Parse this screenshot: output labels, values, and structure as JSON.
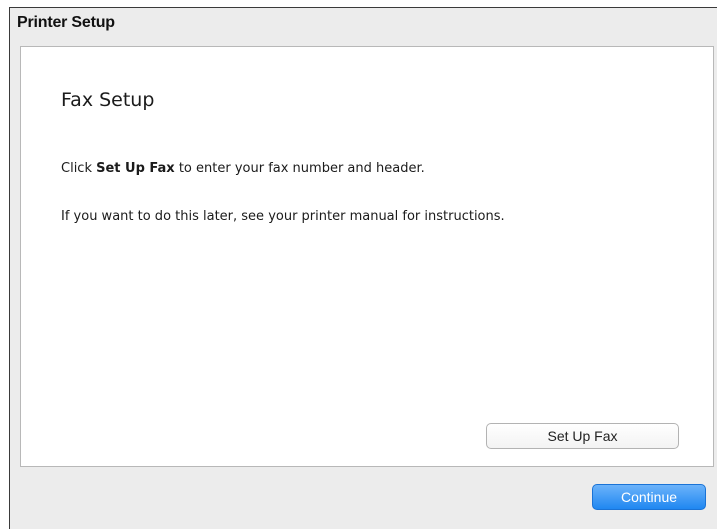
{
  "window": {
    "title": "Printer Setup"
  },
  "panel": {
    "heading": "Fax Setup",
    "line1_prefix": "Click ",
    "line1_bold": "Set Up Fax",
    "line1_suffix": " to enter your fax number and header.",
    "line2": "If you want to do this later, see your printer manual for instructions."
  },
  "buttons": {
    "setup_fax_label": "Set Up Fax",
    "continue_label": "Continue"
  },
  "colors": {
    "accent": "#1f87f1",
    "window_bg": "#ececec",
    "panel_bg": "#ffffff"
  }
}
